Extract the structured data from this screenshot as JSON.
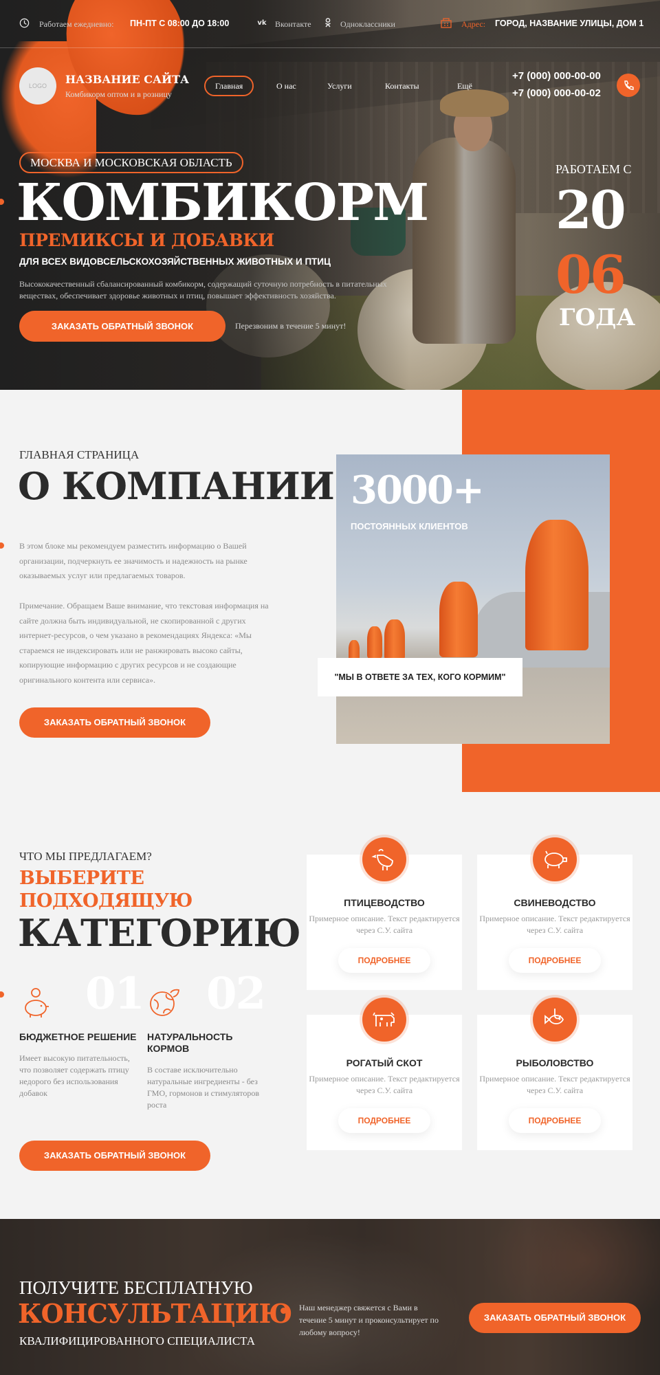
{
  "topbar": {
    "hours_label": "Работаем ежедневно:",
    "hours_value": "ПН-ПТ С 08:00 ДО 18:00",
    "social": [
      "Вконтакте",
      "Одноклассники"
    ],
    "address_label": "Адрес:",
    "address_value": "ГОРОД, НАЗВАНИЕ УЛИЦЫ, ДОМ 1",
    "icons": [
      "clock-icon",
      "vk-icon",
      "ok-icon",
      "building-icon"
    ]
  },
  "header": {
    "logo": "LOGO",
    "site_name": "НАЗВАНИЕ САЙТА",
    "site_tagline": "Комбикорм оптом и в розницу",
    "nav": [
      "Главная",
      "О нас",
      "Услуги",
      "Контакты",
      "Ещё"
    ],
    "phones": [
      "+7 (000) 000-00-00",
      "+7 (000) 000-00-02"
    ]
  },
  "hero": {
    "region": "МОСКВА И МОСКОВСКАЯ ОБЛАСТЬ",
    "title": "КОМБИКОРМ",
    "subtitle": "ПРЕМИКСЫ И ДОБАВКИ",
    "subtitle2": "ДЛЯ ВСЕХ ВИДОВСЕЛЬСКОХОЗЯЙСТВЕННЫХ ЖИВОТНЫХ И ПТИЦ",
    "description": "Высококачественный сбалансированный комбикорм, содержащий суточную потребность в питательных веществах, обеспечивает здоровье животных и птиц, повышает эффективность хозяйства.",
    "cta": "ЗАКАЗАТЬ ОБРАТНЫЙ ЗВОНОК",
    "cta_note": "Перезвоним в течение 5 минут!",
    "since_label": "РАБОТАЕМ С",
    "since_top": "20",
    "since_bottom": "06",
    "since_suffix": "ГОДА"
  },
  "about": {
    "kicker": "ГЛАВНАЯ СТРАНИЦА",
    "title": "О КОМПАНИИ",
    "para1": "В этом блоке мы рекомендуем разместить информацию о Вашей организации, подчеркнуть ее значимость и надежность на рынке оказываемых услуг или предлагаемых товаров.",
    "para2": "Примечание. Обращаем Ваше внимание, что текстовая информация на сайте должна быть индивидуальной, не скопированной с других интернет-ресурсов, о чем указано в рекомендациях Яндекса: «Мы стараемся не индексировать или не ранжировать высоко сайты, копирующие информацию с других ресурсов и не создающие оригинального контента или сервиса».",
    "cta": "ЗАКАЗАТЬ ОБРАТНЫЙ ЗВОНОК",
    "stat_value": "3000+",
    "stat_label": "ПОСТОЯННЫХ КЛИЕНТОВ",
    "quote": "\"МЫ В ОТВЕТЕ ЗА ТЕХ, КОГО КОРМИМ\""
  },
  "offer": {
    "kicker": "ЧТО МЫ ПРЕДЛАГАЕМ?",
    "title_line1": "ВЫБЕРИТЕ",
    "title_line2": "ПОДХОДЯЩУЮ",
    "title_line3": "КАТЕГОРИЮ",
    "features": [
      {
        "num": "01",
        "title": "БЮДЖЕТНОЕ РЕШЕНИЕ",
        "text": "Имеет высокую питательность, что позволяет содержать птицу недорого без использования добавок",
        "icon": "piggy-bank-icon"
      },
      {
        "num": "02",
        "title": "НАТУРАЛЬНОСТЬ КОРМОВ",
        "text": "В составе исключительно натуральные ингредиенты - без ГМО, гормонов и стимуляторов роста",
        "icon": "eco-globe-icon"
      }
    ],
    "cta": "ЗАКАЗАТЬ ОБРАТНЫЙ ЗВОНОК",
    "cards": [
      {
        "title": "ПТИЦЕВОДСТВО",
        "text": "Примерное описание. Текст редактируется через С.У. сайта",
        "button": "ПОДРОБНЕЕ",
        "icon": "rooster-icon"
      },
      {
        "title": "СВИНЕВОДСТВО",
        "text": "Примерное описание. Текст редактируется через С.У. сайта",
        "button": "ПОДРОБНЕЕ",
        "icon": "pig-icon"
      },
      {
        "title": "РОГАТЫЙ СКОТ",
        "text": "Примерное описание. Текст редактируется через С.У. сайта",
        "button": "ПОДРОБНЕЕ",
        "icon": "cow-icon"
      },
      {
        "title": "РЫБОЛОВСТВО",
        "text": "Примерное описание. Текст редактируется через С.У. сайта",
        "button": "ПОДРОБНЕЕ",
        "icon": "fish-hook-icon"
      }
    ]
  },
  "consult": {
    "line1": "ПОЛУЧИТЕ БЕСПЛАТНУЮ",
    "line2": "КОНСУЛЬТАЦИЮ",
    "line3": "КВАЛИФИЦИРОВАННОГО СПЕЦИАЛИСТА",
    "text": "Наш менеджер свяжется с Вами в течение 5 минут и проконсультирует по любому вопросу!",
    "cta": "ЗАКАЗАТЬ ОБРАТНЫЙ ЗВОНОК"
  },
  "colors": {
    "accent": "#f0642a",
    "dark": "#2b2b2b",
    "background": "#f3f3f3"
  }
}
